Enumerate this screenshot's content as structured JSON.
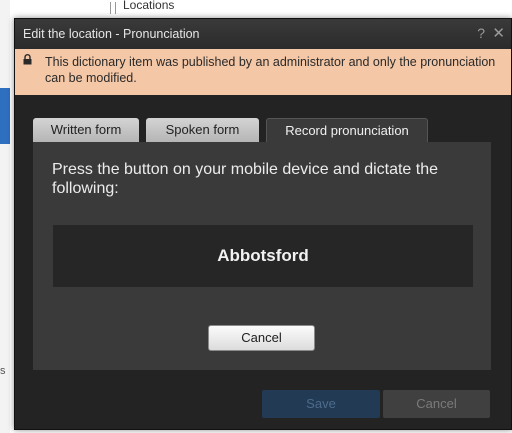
{
  "background": {
    "breadcrumb_title": "Locations",
    "side_letter": "s"
  },
  "dialog": {
    "title": "Edit the location - Pronunciation",
    "help_glyph": "?",
    "close_glyph": "✕",
    "notice": {
      "icon": "lock-icon",
      "text": "This dictionary item was published by an administrator and only the pronunciation can be modified."
    },
    "tabs": [
      {
        "label": "Written form",
        "active": false
      },
      {
        "label": "Spoken form",
        "active": false
      },
      {
        "label": "Record pronunciation",
        "active": true
      }
    ],
    "panel": {
      "instruction": "Press the button on your mobile device and dictate the following:",
      "phrase": "Abbotsford",
      "cancel_label": "Cancel"
    },
    "footer": {
      "save_label": "Save",
      "cancel_label": "Cancel"
    }
  },
  "colors": {
    "notice_background": "#f4c7a6",
    "dialog_background": "#232323",
    "panel_background": "#3a3a3a",
    "save_button": "#233a55"
  }
}
